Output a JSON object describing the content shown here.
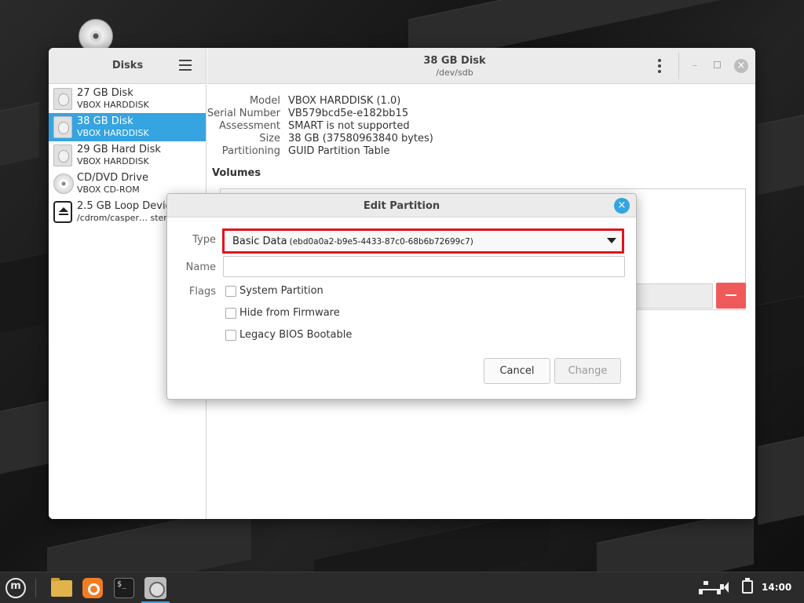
{
  "window": {
    "sidebar_title": "Disks",
    "title": "38 GB Disk",
    "subtitle": "/dev/sdb",
    "minimize_glyph": "–",
    "close_glyph": "×"
  },
  "devices": [
    {
      "name": "27 GB Disk",
      "sub": "VBOX HARDDISK",
      "icon": "hard-disk-icon"
    },
    {
      "name": "38 GB Disk",
      "sub": "VBOX HARDDISK",
      "icon": "hard-disk-icon"
    },
    {
      "name": "29 GB Hard Disk",
      "sub": "VBOX HARDDISK",
      "icon": "hard-disk-icon"
    },
    {
      "name": "CD/DVD Drive",
      "sub": "VBOX CD-ROM",
      "icon": "optical-disc-icon"
    },
    {
      "name": "2.5 GB Loop Device",
      "sub": "/cdrom/casper… stem…",
      "icon": "eject-icon"
    }
  ],
  "selected_device": "38 GB Disk",
  "disk_info": {
    "model_label": "Model",
    "model_value": "VBOX HARDDISK (1.0)",
    "serial_label": "Serial Number",
    "serial_value": "VB579bcd5e-e182bb15",
    "assessment_label": "Assessment",
    "assessment_value": "SMART is not supported",
    "size_label": "Size",
    "size_value": "38 GB (37580963840 bytes)",
    "partitioning_label": "Partitioning",
    "partitioning_value": "GUID Partition Table"
  },
  "volumes_title": "Volumes",
  "dialog": {
    "title": "Edit Partition",
    "close_glyph": "×",
    "type_label": "Type",
    "type_value": "Basic Data",
    "type_guid": "(ebd0a0a2-b9e5-4433-87c0-68b6b72699c7)",
    "name_label": "Name",
    "name_value": "",
    "flags_label": "Flags",
    "flags": [
      {
        "label": "System Partition",
        "checked": false
      },
      {
        "label": "Hide from Firmware",
        "checked": false
      },
      {
        "label": "Legacy BIOS Bootable",
        "checked": false
      }
    ],
    "cancel_label": "Cancel",
    "change_label": "Change"
  },
  "taskbar": {
    "terminal_glyph": "$_",
    "clock": "14:00"
  },
  "colors": {
    "accent": "#35a4e0",
    "highlight_border": "#e0131d",
    "delete_button": "#f05a5a"
  }
}
